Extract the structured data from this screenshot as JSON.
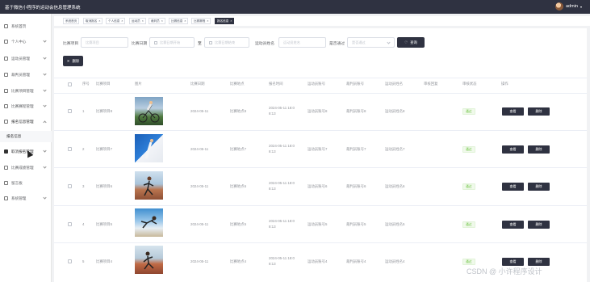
{
  "header": {
    "title": "基于微信小程序的运动会信息管理系统",
    "user": "admin"
  },
  "sidebar": {
    "items": [
      {
        "label": "系统首页"
      },
      {
        "label": "个人中心"
      },
      {
        "label": "运动员管理"
      },
      {
        "label": "裁判员管理"
      },
      {
        "label": "比赛项目管理"
      },
      {
        "label": "比赛赛程管理"
      },
      {
        "label": "报名信息管理"
      },
      {
        "label": "报名信息"
      },
      {
        "label": "取消报名管理"
      },
      {
        "label": "比赛成绩管理"
      },
      {
        "label": "留言板"
      },
      {
        "label": "系统管理"
      }
    ]
  },
  "tags": [
    "系统首页",
    "取消报名",
    "个人信息",
    "运动员",
    "裁判员",
    "比赛信息",
    "比赛赛程",
    "报名信息"
  ],
  "search": {
    "project_label": "比赛项目",
    "project_placeholder": "比赛项目",
    "date_label": "比赛日期",
    "date_start": "比赛日期开始",
    "date_sep": "至",
    "date_end": "比赛日期结束",
    "athlete_label": "运动员姓名",
    "athlete_placeholder": "运动员姓名",
    "pass_label": "是否通过",
    "pass_placeholder": "是否通过",
    "query_button": "查询",
    "delete_button": "删除"
  },
  "table": {
    "headers": [
      "序号",
      "比赛项目",
      "图片",
      "比赛日期",
      "比赛地点",
      "报名时间",
      "运动员账号",
      "裁判员账号",
      "运动员姓名",
      "审核回复",
      "审核状态",
      "操作"
    ],
    "rows": [
      {
        "index": "1",
        "project": "比赛项目8",
        "date": "2024-05-11",
        "venue": "比赛地点8",
        "time1": "2024-05-11 18:0",
        "time2": "8:13",
        "acct": "运动员账号8",
        "ref": "裁判员账号8",
        "name": "运动员姓名8",
        "status": "通过"
      },
      {
        "index": "2",
        "project": "比赛项目7",
        "date": "2024-05-11",
        "venue": "比赛地点7",
        "time1": "2024-05-11 18:0",
        "time2": "8:13",
        "acct": "运动员账号7",
        "ref": "裁判员账号7",
        "name": "运动员姓名7",
        "status": "通过"
      },
      {
        "index": "3",
        "project": "比赛项目6",
        "date": "2024-05-11",
        "venue": "比赛地点6",
        "time1": "2024-05-11 18:0",
        "time2": "8:13",
        "acct": "运动员账号6",
        "ref": "裁判员账号6",
        "name": "运动员姓名6",
        "status": "通过"
      },
      {
        "index": "4",
        "project": "比赛项目5",
        "date": "2024-05-11",
        "venue": "比赛地点5",
        "time1": "2024-05-11 18:0",
        "time2": "8:13",
        "acct": "运动员账号5",
        "ref": "裁判员账号5",
        "name": "运动员姓名5",
        "status": "通过"
      },
      {
        "index": "5",
        "project": "比赛项目4",
        "date": "2024-05-11",
        "venue": "比赛地点4",
        "time1": "2024-05-11 18:0",
        "time2": "8:13",
        "acct": "运动员账号4",
        "ref": "裁判员账号4",
        "name": "运动员姓名4",
        "status": "通过"
      }
    ],
    "view_button": "查看",
    "delete_button": "删除"
  },
  "watermark": "CSDN @ 小许程序设计",
  "colors": {
    "primary": "#2f3241",
    "success": "#67c23a",
    "page_bg": "#f1f2f4"
  }
}
